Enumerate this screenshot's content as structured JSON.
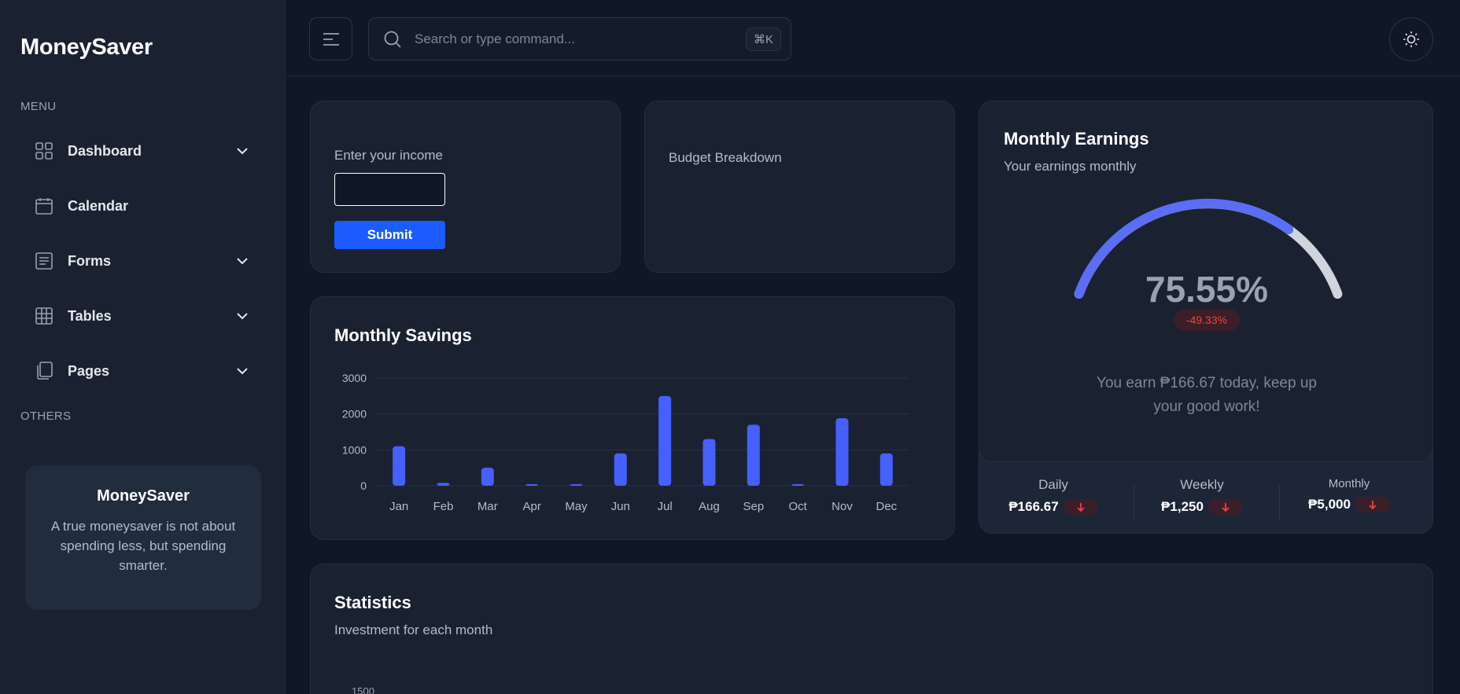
{
  "app": {
    "brand": "MoneySaver"
  },
  "sidebar": {
    "menu_label": "MENU",
    "others_label": "OTHERS",
    "items": [
      {
        "label": "Dashboard",
        "icon": "grid-icon",
        "has_chevron": true
      },
      {
        "label": "Calendar",
        "icon": "calendar-icon",
        "has_chevron": false
      },
      {
        "label": "Forms",
        "icon": "forms-icon",
        "has_chevron": true
      },
      {
        "label": "Tables",
        "icon": "table-icon",
        "has_chevron": true
      },
      {
        "label": "Pages",
        "icon": "pages-icon",
        "has_chevron": true
      }
    ],
    "promo": {
      "title": "MoneySaver",
      "text": "A true moneysaver is not about spending less, but spending smarter."
    }
  },
  "header": {
    "search_placeholder": "Search or type command...",
    "shortcut": "⌘K"
  },
  "income": {
    "label": "Enter your income",
    "input_value": "",
    "submit_label": "Submit"
  },
  "budget": {
    "title": "Budget Breakdown"
  },
  "earnings": {
    "title": "Monthly Earnings",
    "subtitle": "Your earnings monthly",
    "percent_value": 75.55,
    "percent_text": "75.55%",
    "change": "-49.33%",
    "message": "You earn ₱166.67 today, keep up your good work!",
    "stats": [
      {
        "label": "Daily",
        "value": "₱166.67"
      },
      {
        "label": "Weekly",
        "value": "₱1,250"
      },
      {
        "label": "Monthly",
        "value": "₱5,000"
      }
    ]
  },
  "savings": {
    "title": "Monthly Savings"
  },
  "statistics": {
    "title": "Statistics",
    "subtitle": "Investment for each month",
    "first_tick": "1500"
  },
  "colors": {
    "accent": "#465fff",
    "primary_button": "#1b5cff",
    "negative": "#f04438",
    "background": "#101828",
    "card": "#1a2231"
  },
  "chart_data": {
    "type": "bar",
    "categories": [
      "Jan",
      "Feb",
      "Mar",
      "Apr",
      "May",
      "Jun",
      "Jul",
      "Aug",
      "Sep",
      "Oct",
      "Nov",
      "Dec"
    ],
    "values": [
      1100,
      80,
      500,
      20,
      30,
      900,
      2500,
      1300,
      1700,
      40,
      1880,
      900
    ],
    "yticks": [
      0,
      1000,
      2000,
      3000
    ],
    "ylim": [
      0,
      3000
    ],
    "grid": true,
    "color": "#465fff"
  }
}
